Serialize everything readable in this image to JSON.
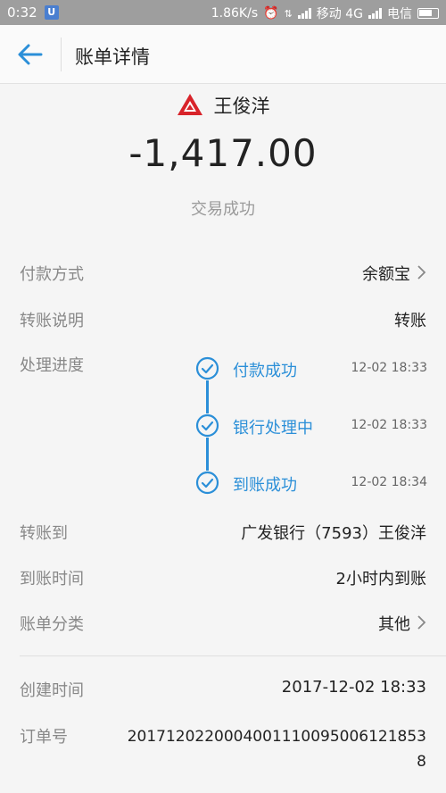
{
  "status_bar": {
    "time": "0:32",
    "badge": "U",
    "speed": "1.86K/s",
    "carrier1": "移动 4G",
    "carrier2": "电信"
  },
  "header": {
    "title": "账单详情"
  },
  "summary": {
    "payee_name": "王俊洋",
    "amount": "-1,417.00",
    "status": "交易成功"
  },
  "details": {
    "payment_method_label": "付款方式",
    "payment_method_value": "余额宝",
    "transfer_note_label": "转账说明",
    "transfer_note_value": "转账",
    "progress_label": "处理进度",
    "progress_steps": [
      {
        "label": "付款成功",
        "time": "12-02 18:33"
      },
      {
        "label": "银行处理中",
        "time": "12-02 18:33"
      },
      {
        "label": "到账成功",
        "time": "12-02 18:34"
      }
    ],
    "transfer_to_label": "转账到",
    "transfer_to_value": "广发银行（7593）王俊洋",
    "arrival_time_label": "到账时间",
    "arrival_time_value": "2小时内到账",
    "category_label": "账单分类",
    "category_value": "其他"
  },
  "meta": {
    "created_label": "创建时间",
    "created_value": "2017-12-02 18:33",
    "order_label": "订单号",
    "order_value": "20171202200040011100950061218538"
  },
  "colors": {
    "accent": "#2b8fd8",
    "bank_logo": "#d8232a",
    "status_bar": "#9e9e9e"
  }
}
